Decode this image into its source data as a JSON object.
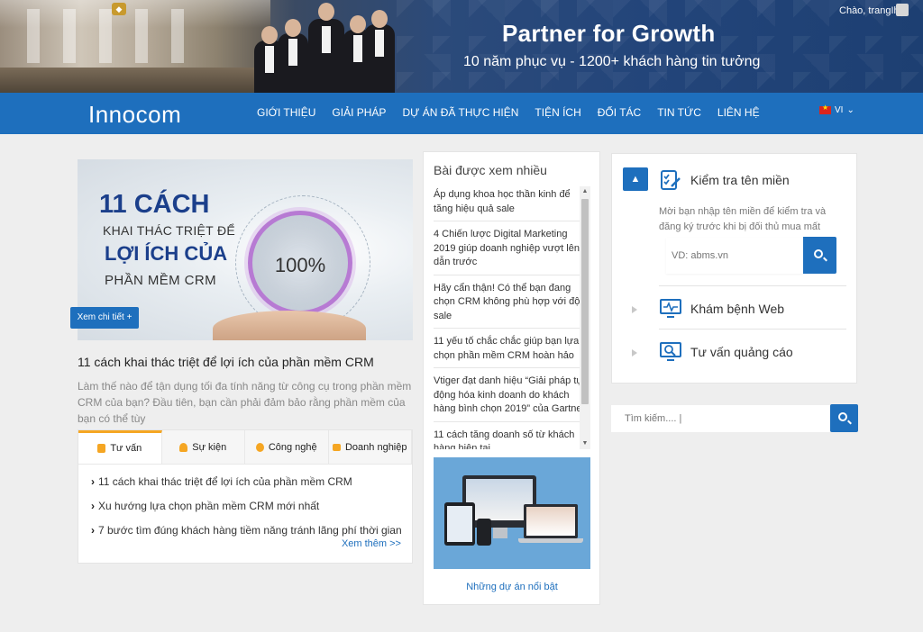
{
  "hero": {
    "tagline": "Partner for Growth",
    "subtagline": "10 năm phục vụ - 1200+ khách hàng tin tưởng",
    "greeting": "Chào, trangIh"
  },
  "nav": {
    "brand": "Innocom",
    "items": [
      {
        "label": "GIỚI THIỆU"
      },
      {
        "label": "GIẢI PHÁP"
      },
      {
        "label": "DỰ ÁN ĐÃ THỰC HIỆN"
      },
      {
        "label": "TIỆN ÍCH"
      },
      {
        "label": "ĐỐI TÁC"
      },
      {
        "label": "TIN TỨC"
      },
      {
        "label": "LIÊN HỆ"
      }
    ],
    "language": "VI"
  },
  "feature": {
    "image_text": {
      "line1": "11 CÁCH",
      "line2": "KHAI THÁC TRIỆT ĐỂ",
      "line3": "LỢI ÍCH CỦA",
      "line4": "PHẦN MỀM CRM",
      "ring_value": "100%"
    },
    "more_button": "Xem chi tiết +",
    "title": "11 cách khai thác triệt để lợi ích của phần mềm CRM",
    "description": "Làm thế nào để tận dụng tối đa tính năng từ công cụ trong phần mềm CRM của bạn? Đầu tiên, bạn cần phải đảm bảo rằng phần mềm của bạn có thể tùy"
  },
  "tabs": {
    "items": [
      {
        "label": "Tư vấn",
        "icon": "document-icon"
      },
      {
        "label": "Sự kiện",
        "icon": "bell-icon"
      },
      {
        "label": "Công nghệ",
        "icon": "gear-icon"
      },
      {
        "label": "Doanh nghiệp",
        "icon": "briefcase-icon"
      }
    ],
    "active": "Tư vấn",
    "articles": [
      "11 cách khai thác triệt để lợi ích của phần mềm CRM",
      "Xu hướng lựa chọn phần mềm CRM mới nhất",
      "7 bước tìm đúng khách hàng tiềm năng tránh lãng phí thời gian"
    ],
    "see_more": "Xem thêm >>"
  },
  "popular": {
    "title": "Bài được xem nhiều",
    "items": [
      "Áp dụng khoa học thần kinh để tăng hiệu quả sale",
      "4 Chiến lược Digital Marketing 2019 giúp doanh nghiệp vượt lên dẫn trước",
      "Hãy cẩn thận! Có thể bạn đang chọn CRM không phù hợp với đội sale",
      "11 yếu tố chắc chắc giúp bạn lựa chọn phần mềm CRM hoàn hảo",
      "Vtiger đạt danh hiệu “Giải pháp tự động hóa kinh doanh do khách hàng bình chọn 2019” của Gartner",
      "11 cách tăng doanh số từ khách hàng hiện tại"
    ],
    "projects_caption": "Những dự án nổi bật"
  },
  "services": {
    "domain": {
      "title": "Kiểm tra tên miền",
      "description": "Mời bạn nhập tên miền để kiểm tra và đăng ký trước khi bị đối thủ mua mất",
      "placeholder": "VD: abms.vn"
    },
    "web_check": {
      "title": "Khám bệnh Web"
    },
    "ads": {
      "title": "Tư vấn quảng cáo"
    }
  },
  "site_search": {
    "placeholder": "Tìm kiếm.... |"
  },
  "colors": {
    "primary": "#1e6fbd",
    "accent": "#f5a623",
    "background": "#eeeeee"
  }
}
